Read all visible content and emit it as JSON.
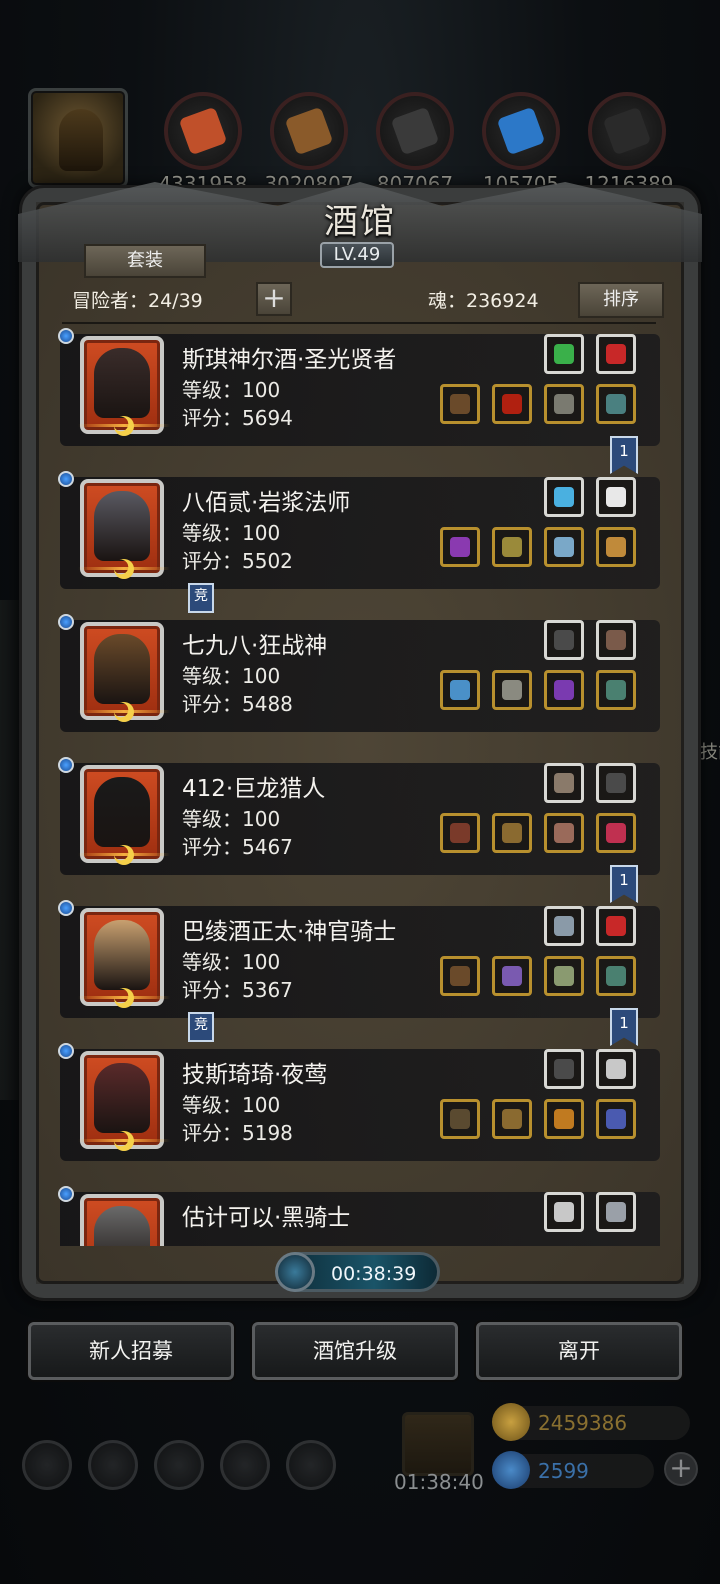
{
  "resources": [
    {
      "value": "4331958",
      "icon": "hood-icon",
      "color": "#c0502a"
    },
    {
      "value": "3020807",
      "icon": "wood-plank-icon",
      "color": "#8a5a2a"
    },
    {
      "value": "807067",
      "icon": "iron-bar-icon",
      "color": "#3a3a3a"
    },
    {
      "value": "105705",
      "icon": "blue-crystal-icon",
      "color": "#2c78c8"
    },
    {
      "value": "1216389",
      "icon": "dark-ingot-icon",
      "color": "#2a2a2a"
    }
  ],
  "tavern": {
    "title": "酒馆",
    "level": "LV.49",
    "suit_button": "套装",
    "adventurers_label": "冒险者：24/39",
    "add_button": "+",
    "soul_label": "魂：236924",
    "sort_button": "排序"
  },
  "heroes": [
    {
      "name": "斯琪神尔酒·圣光贤者",
      "level": "等级：100",
      "score": "评分：5694",
      "face_color": "#3a2c2a",
      "equip_top": [
        "#3ab04a",
        "#c82828"
      ],
      "equip_bottom": [
        "#6a4a2a",
        "#b02010",
        "#7a7a70",
        "#4a8080"
      ],
      "ribbon": "1",
      "tag": ""
    },
    {
      "name": "八佰贰·岩浆法师",
      "level": "等级：100",
      "score": "评分：5502",
      "face_color": "#5a5a62",
      "equip_top": [
        "#4ab0e0",
        "#e8e8e8"
      ],
      "equip_bottom": [
        "#8a3ab0",
        "#9a8a3a",
        "#7aa8c8",
        "#c08a3a"
      ],
      "ribbon": "",
      "tag": "竞"
    },
    {
      "name": "七九八·狂战神",
      "level": "等级：100",
      "score": "评分：5488",
      "face_color": "#6a4a2a",
      "equip_top": [
        "#4a4a4a",
        "#7a5a4a"
      ],
      "equip_bottom": [
        "#4a90c8",
        "#8a8a80",
        "#7a3ab0",
        "#4a8070"
      ],
      "ribbon": "",
      "tag": ""
    },
    {
      "name": "412·巨龙猎人",
      "level": "等级：100",
      "score": "评分：5467",
      "face_color": "#1a1a1a",
      "equip_top": [
        "#8a7a6a",
        "#4a4a4a"
      ],
      "equip_bottom": [
        "#7a3a2a",
        "#8a6a30",
        "#9a6a5a",
        "#c03050"
      ],
      "ribbon": "1",
      "tag": ""
    },
    {
      "name": "巴绫酒正太·神官骑士",
      "level": "等级：100",
      "score": "评分：5367",
      "face_color": "#c8a070",
      "equip_top": [
        "#8a9aa8",
        "#c82828"
      ],
      "equip_bottom": [
        "#6a4a2a",
        "#7a5ab0",
        "#8a9a70",
        "#4a8070"
      ],
      "ribbon": "1",
      "tag": "竞"
    },
    {
      "name": "技斯琦琦·夜莺",
      "level": "等级：100",
      "score": "评分：5198",
      "face_color": "#5a2a2a",
      "equip_top": [
        "#4a4a4a",
        "#c8c8c8"
      ],
      "equip_bottom": [
        "#5a4a30",
        "#8a6a30",
        "#c07a20",
        "#4a5ab0"
      ],
      "ribbon": "",
      "tag": ""
    },
    {
      "name": "估计可以·黑骑士",
      "level": "",
      "score": "",
      "face_color": "#6a6a6a",
      "equip_top": [
        "#c8c8c8",
        "#9aa0a8"
      ],
      "equip_bottom": [],
      "ribbon": "",
      "tag": ""
    }
  ],
  "timer": "00:38:39",
  "buttons": {
    "recruit": "新人招募",
    "upgrade": "酒馆升级",
    "leave": "离开"
  },
  "bottom_bar": {
    "gift_timer": "01:38:40",
    "gold": "2459386",
    "gems": "2599",
    "plus": "+"
  },
  "side_text": "技能"
}
